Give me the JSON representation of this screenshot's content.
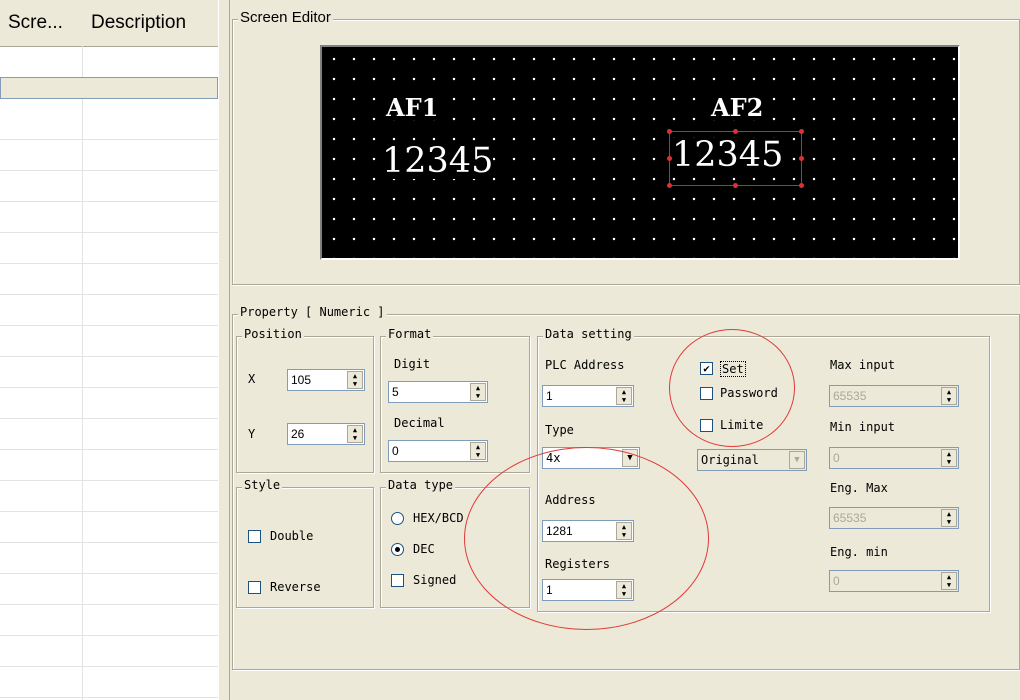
{
  "list": {
    "col1": "Scre...",
    "col2": "Description"
  },
  "screen_editor": {
    "title": "Screen Editor",
    "labels": [
      "AF1",
      "AF2"
    ],
    "values": [
      "12345",
      "12345"
    ]
  },
  "property": {
    "title": "Property [ Numeric ]",
    "position": {
      "title": "Position",
      "x_label": "X",
      "x_value": "105",
      "y_label": "Y",
      "y_value": "26"
    },
    "format": {
      "title": "Format",
      "digit_label": "Digit",
      "digit_value": "5",
      "decimal_label": "Decimal",
      "decimal_value": "0"
    },
    "style": {
      "title": "Style",
      "double_label": "Double",
      "reverse_label": "Reverse"
    },
    "data_type": {
      "title": "Data type",
      "hex_label": "HEX/BCD",
      "dec_label": "DEC",
      "signed_label": "Signed",
      "selected": "DEC"
    },
    "data_setting": {
      "title": "Data setting",
      "plc_address_label": "PLC Address",
      "plc_address_value": "1",
      "type_label": "Type",
      "type_value": "4x",
      "address_label": "Address",
      "address_value": "1281",
      "registers_label": "Registers",
      "registers_value": "1",
      "set_label": "Set",
      "set_checked": true,
      "password_label": "Password",
      "limite_label": "Limite",
      "display_value": "Original",
      "max_input_label": "Max input",
      "max_input_value": "65535",
      "min_input_label": "Min input",
      "min_input_value": "0",
      "eng_max_label": "Eng. Max",
      "eng_max_value": "65535",
      "eng_min_label": "Eng. min",
      "eng_min_value": "0"
    }
  },
  "icons": {
    "spin": "up-down-arrows",
    "dropdown": "chevron-down",
    "check": "checkmark"
  },
  "colors": {
    "window_bg": "#ece9d8",
    "screen_bg": "#000000",
    "annotation": "#e03a3a",
    "selection": "#3a4fd8"
  }
}
